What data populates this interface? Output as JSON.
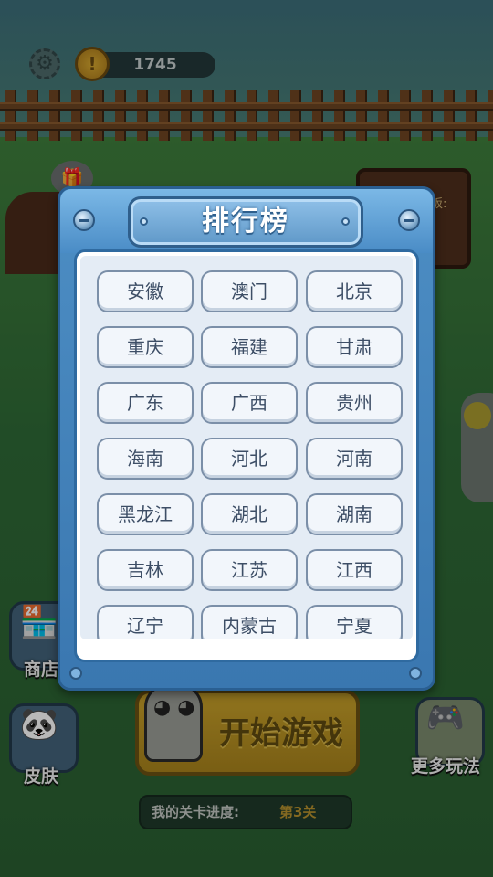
{
  "top_bar": {
    "coins": "1745"
  },
  "background": {
    "board_text": "板:",
    "buttons": {
      "shop_label": "商店",
      "skin_label": "皮肤",
      "more_label": "更多玩法",
      "start_label": "开始游戏"
    },
    "progress": {
      "label": "我的关卡进度:",
      "value": "第3关"
    }
  },
  "leaderboard": {
    "title": "排行榜",
    "provinces": [
      "安徽",
      "澳门",
      "北京",
      "重庆",
      "福建",
      "甘肃",
      "广东",
      "广西",
      "贵州",
      "海南",
      "河北",
      "河南",
      "黑龙江",
      "湖北",
      "湖南",
      "吉林",
      "江苏",
      "江西",
      "辽宁",
      "内蒙古",
      "宁夏"
    ]
  },
  "icons": {
    "settings": "gear-icon",
    "coin": "coin-icon",
    "rivet": "rivet-icon"
  },
  "colors": {
    "modal_blue": "#3a77b0",
    "start_gold": "#c8a12a",
    "province_text": "#3d4e66"
  }
}
